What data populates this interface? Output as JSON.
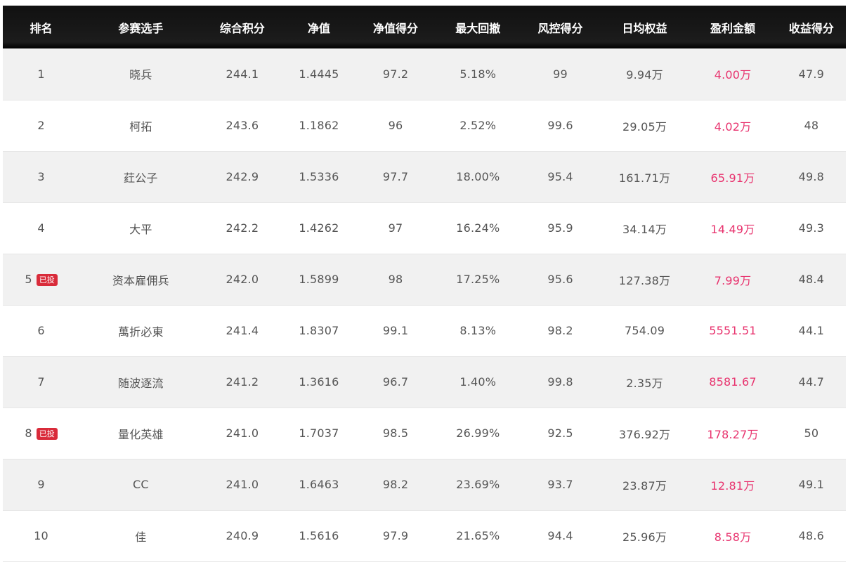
{
  "headers": [
    "排名",
    "参赛选手",
    "综合积分",
    "净值",
    "净值得分",
    "最大回撤",
    "风控得分",
    "日均权益",
    "盈利金额",
    "收益得分"
  ],
  "badge_label": "已投",
  "colors": {
    "header_bg": "#111111",
    "row_alt_bg": "#f1f1f1",
    "profit_text": "#e8336e",
    "badge_bg": "#d92b3a"
  },
  "rows": [
    {
      "rank": "1",
      "badge": "",
      "name": "晓兵",
      "score": "244.1",
      "nav": "1.4445",
      "nav_score": "97.2",
      "max_drawdown": "5.18%",
      "risk_score": "99",
      "avg_equity": "9.94万",
      "profit": "4.00万",
      "return_score": "47.9"
    },
    {
      "rank": "2",
      "badge": "",
      "name": "柯拓",
      "score": "243.6",
      "nav": "1.1862",
      "nav_score": "96",
      "max_drawdown": "2.52%",
      "risk_score": "99.6",
      "avg_equity": "29.05万",
      "profit": "4.02万",
      "return_score": "48"
    },
    {
      "rank": "3",
      "badge": "",
      "name": "荭公子",
      "score": "242.9",
      "nav": "1.5336",
      "nav_score": "97.7",
      "max_drawdown": "18.00%",
      "risk_score": "95.4",
      "avg_equity": "161.71万",
      "profit": "65.91万",
      "return_score": "49.8"
    },
    {
      "rank": "4",
      "badge": "",
      "name": "大平",
      "score": "242.2",
      "nav": "1.4262",
      "nav_score": "97",
      "max_drawdown": "16.24%",
      "risk_score": "95.9",
      "avg_equity": "34.14万",
      "profit": "14.49万",
      "return_score": "49.3"
    },
    {
      "rank": "5",
      "badge": "已投",
      "name": "资本雇佣兵",
      "score": "242.0",
      "nav": "1.5899",
      "nav_score": "98",
      "max_drawdown": "17.25%",
      "risk_score": "95.6",
      "avg_equity": "127.38万",
      "profit": "7.99万",
      "return_score": "48.4"
    },
    {
      "rank": "6",
      "badge": "",
      "name": "萬折必東",
      "score": "241.4",
      "nav": "1.8307",
      "nav_score": "99.1",
      "max_drawdown": "8.13%",
      "risk_score": "98.2",
      "avg_equity": "754.09",
      "profit": "5551.51",
      "return_score": "44.1"
    },
    {
      "rank": "7",
      "badge": "",
      "name": "随波逐流",
      "score": "241.2",
      "nav": "1.3616",
      "nav_score": "96.7",
      "max_drawdown": "1.40%",
      "risk_score": "99.8",
      "avg_equity": "2.35万",
      "profit": "8581.67",
      "return_score": "44.7"
    },
    {
      "rank": "8",
      "badge": "已投",
      "name": "量化英雄",
      "score": "241.0",
      "nav": "1.7037",
      "nav_score": "98.5",
      "max_drawdown": "26.99%",
      "risk_score": "92.5",
      "avg_equity": "376.92万",
      "profit": "178.27万",
      "return_score": "50"
    },
    {
      "rank": "9",
      "badge": "",
      "name": "CC",
      "score": "241.0",
      "nav": "1.6463",
      "nav_score": "98.2",
      "max_drawdown": "23.69%",
      "risk_score": "93.7",
      "avg_equity": "23.87万",
      "profit": "12.81万",
      "return_score": "49.1"
    },
    {
      "rank": "10",
      "badge": "",
      "name": "佳",
      "score": "240.9",
      "nav": "1.5616",
      "nav_score": "97.9",
      "max_drawdown": "21.65%",
      "risk_score": "94.4",
      "avg_equity": "25.96万",
      "profit": "8.58万",
      "return_score": "48.6"
    }
  ]
}
